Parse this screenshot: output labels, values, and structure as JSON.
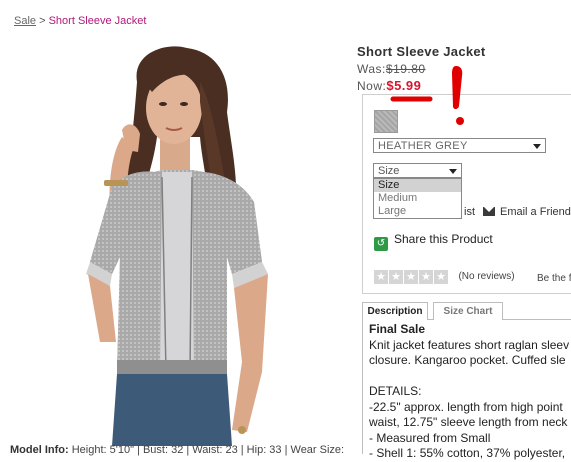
{
  "breadcrumb": {
    "home": "Sale",
    "separator": ">",
    "current": "Short Sleeve Jacket"
  },
  "product": {
    "title": "Short Sleeve Jacket",
    "was_label": "Was:",
    "was_price": "$19.80",
    "now_label": "Now:",
    "now_price": "$5.99",
    "color_value": "HEATHER GREY",
    "size_value": "Size",
    "size_options": [
      "Size",
      "Medium",
      "Large"
    ],
    "wishlist_tail": "ist",
    "email_friend": "Email a Friend",
    "share": "Share this Product",
    "reviews": "(No reviews)",
    "be_first": "Be the f"
  },
  "tabs": {
    "description": "Description",
    "size_chart": "Size Chart"
  },
  "description": {
    "title": "Final Sale",
    "lines": [
      "Knit jacket features short raglan sleev",
      "closure. Kangaroo pocket. Cuffed sle",
      "",
      "DETAILS:",
      "-22.5\" approx. length from high point",
      "waist, 12.75\" sleeve length from neck",
      "- Measured from Small",
      "- Shell 1: 55% cotton, 37% polyester,"
    ]
  },
  "model_info": {
    "label": "Model Info:",
    "text": " Height: 5'10\" | Bust: 32 | Waist: 23 | Hip: 33 | Wear Size:"
  },
  "rating": {
    "stars_filled": 0,
    "stars_total": 5
  },
  "colors": {
    "accent_pink": "#b0187a",
    "price_red": "#d7142d",
    "annotation_red": "#e10000",
    "share_green": "#2f9a45"
  },
  "icons": {
    "email": "mail-icon",
    "share": "share-icon",
    "star": "star-icon",
    "dropdown": "chevron-down-icon"
  }
}
